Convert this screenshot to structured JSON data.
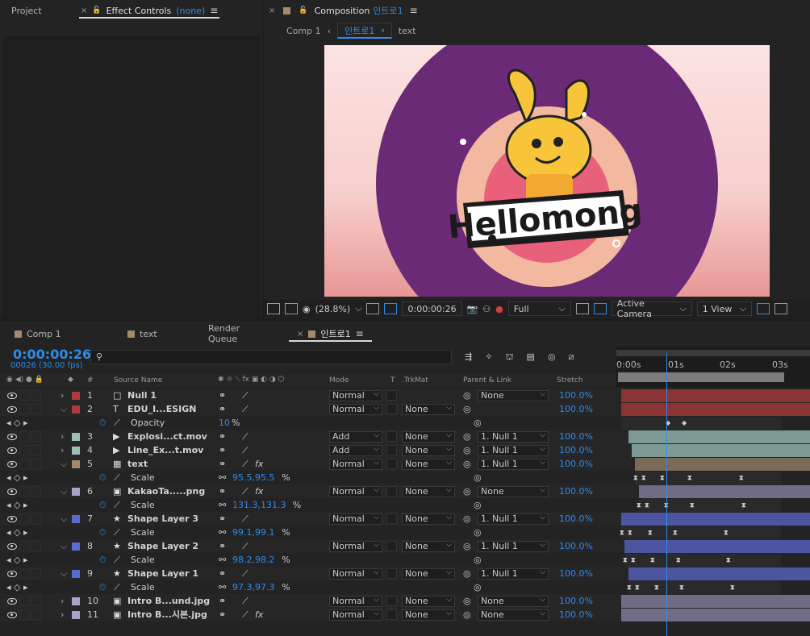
{
  "left_panel": {
    "tab_project": "Project",
    "tab_effect_controls": "Effect Controls",
    "effect_target": "(none)"
  },
  "comp_panel": {
    "title": "Composition",
    "comp_name": "인트로1",
    "breadcrumb": [
      "Comp 1",
      "인트로1",
      "text"
    ],
    "viewer": {
      "zoom": "(28.8%)",
      "timecode": "0:00:00:26",
      "resolution": "Full",
      "camera": "Active Camera",
      "views": "1 View"
    },
    "artwork_text": "Hellomong"
  },
  "timeline": {
    "tabs": [
      "Comp 1",
      "text",
      "Render Queue",
      "인트로1"
    ],
    "timecode": "0:00:00:26",
    "frame_info": "00026 (30.00 fps)",
    "columns": {
      "source_name": "Source Name",
      "mode": "Mode",
      "t": "T",
      "trkmat": ".TrkMat",
      "parent": "Parent & Link",
      "stretch": "Stretch",
      "hash": "#"
    },
    "ruler": [
      "0:00s",
      "01s",
      "02s",
      "03s"
    ],
    "layers": [
      {
        "num": "1",
        "name": "Null 1",
        "icon": "solid-icon",
        "label": "#b03a3a",
        "mode": "Normal",
        "trkmat": "",
        "parent": "None",
        "stretch": "100.0%",
        "fx": false,
        "expanded": false
      },
      {
        "num": "2",
        "name": "EDU_I...ESIGN",
        "icon": "text-layer-icon",
        "label": "#b03a3a",
        "mode": "Normal",
        "trkmat": "None",
        "parent": "",
        "stretch": "100.0%",
        "fx": false,
        "expanded": true,
        "prop": {
          "name": "Opacity",
          "value": "10",
          "unit": "%"
        }
      },
      {
        "num": "3",
        "name": "Explosi...ct.mov",
        "icon": "video-icon",
        "label": "#9bbfb8",
        "mode": "Add",
        "trkmat": "None",
        "parent": "1. Null 1",
        "stretch": "100.0%",
        "fx": false,
        "expanded": false
      },
      {
        "num": "4",
        "name": "Line_Ex...t.mov",
        "icon": "video-icon",
        "label": "#9bbfb8",
        "mode": "Add",
        "trkmat": "None",
        "parent": "1. Null 1",
        "stretch": "100.0%",
        "fx": false,
        "expanded": false
      },
      {
        "num": "5",
        "name": "text",
        "icon": "precomp-icon",
        "label": "#a48a6b",
        "mode": "Normal",
        "trkmat": "None",
        "parent": "1. Null 1",
        "stretch": "100.0%",
        "fx": true,
        "expanded": true,
        "prop": {
          "name": "Scale",
          "value": "95.5,95.5",
          "unit": "%"
        }
      },
      {
        "num": "6",
        "name": "KakaoTa.....png",
        "icon": "image-icon",
        "label": "#a7a3c9",
        "mode": "Normal",
        "trkmat": "None",
        "parent": "None",
        "stretch": "100.0%",
        "fx": true,
        "expanded": true,
        "prop": {
          "name": "Scale",
          "value": "131.3,131.3",
          "unit": "%"
        }
      },
      {
        "num": "7",
        "name": "Shape Layer 3",
        "icon": "star-icon",
        "label": "#5a6ccc",
        "mode": "Normal",
        "trkmat": "None",
        "parent": "1. Null 1",
        "stretch": "100.0%",
        "fx": false,
        "expanded": true,
        "prop": {
          "name": "Scale",
          "value": "99.1,99.1",
          "unit": "%"
        }
      },
      {
        "num": "8",
        "name": "Shape Layer 2",
        "icon": "star-icon",
        "label": "#5a6ccc",
        "mode": "Normal",
        "trkmat": "None",
        "parent": "1. Null 1",
        "stretch": "100.0%",
        "fx": false,
        "expanded": true,
        "prop": {
          "name": "Scale",
          "value": "98.2,98.2",
          "unit": "%"
        }
      },
      {
        "num": "9",
        "name": "Shape Layer 1",
        "icon": "star-icon",
        "label": "#5a6ccc",
        "mode": "Normal",
        "trkmat": "None",
        "parent": "1. Null 1",
        "stretch": "100.0%",
        "fx": false,
        "expanded": true,
        "prop": {
          "name": "Scale",
          "value": "97.3,97.3",
          "unit": "%"
        }
      },
      {
        "num": "10",
        "name": "Intro B...und.jpg",
        "icon": "image-icon",
        "label": "#a7a3c9",
        "mode": "Normal",
        "trkmat": "None",
        "parent": "None",
        "stretch": "100.0%",
        "fx": false,
        "expanded": false
      },
      {
        "num": "11",
        "name": "Intro B...시본.jpg",
        "icon": "image-icon",
        "label": "#a7a3c9",
        "mode": "Normal",
        "trkmat": "None",
        "parent": "None",
        "stretch": "100.0%",
        "fx": true,
        "expanded": false
      }
    ]
  },
  "colors": {
    "accent": "#2d8ceb",
    "purple": "#6a2a75",
    "yellow": "#f8c53a"
  }
}
